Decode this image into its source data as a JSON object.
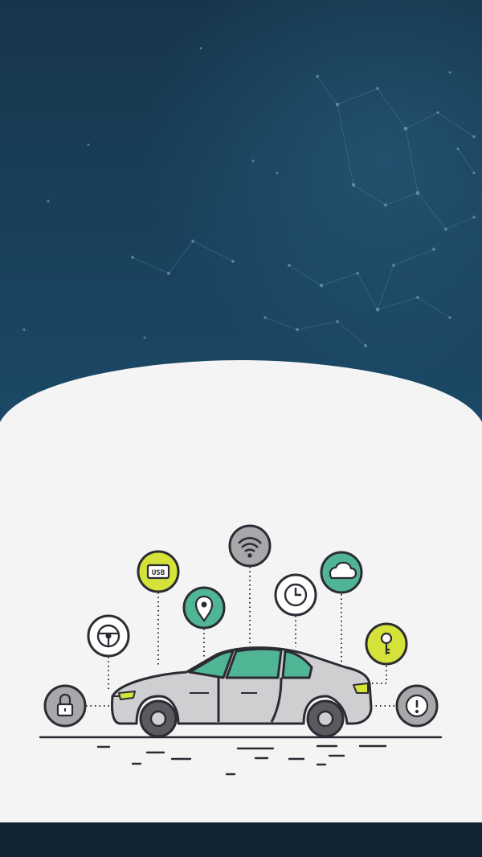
{
  "colors": {
    "sky_top": "#17364d",
    "sky_bottom": "#1a4a67",
    "panel": "#f4f4f4",
    "footer": "#122434",
    "outline": "#2b2b33",
    "car_body": "#cfcfd1",
    "glass": "#4fb594",
    "accent_lime": "#d4e23a",
    "accent_green": "#4fb594",
    "neutral_gray": "#a8a8aa",
    "white_fill": "#ffffff"
  },
  "icons": [
    {
      "name": "lock-icon",
      "fill": "neutral_gray"
    },
    {
      "name": "steering-wheel-icon",
      "fill": "white_fill"
    },
    {
      "name": "usb-icon",
      "fill": "accent_lime",
      "label": "USB"
    },
    {
      "name": "location-pin-icon",
      "fill": "accent_green"
    },
    {
      "name": "wifi-icon",
      "fill": "neutral_gray"
    },
    {
      "name": "clock-icon",
      "fill": "white_fill"
    },
    {
      "name": "cloud-icon",
      "fill": "accent_green"
    },
    {
      "name": "key-icon",
      "fill": "accent_lime"
    },
    {
      "name": "alert-icon",
      "fill": "neutral_gray"
    }
  ]
}
